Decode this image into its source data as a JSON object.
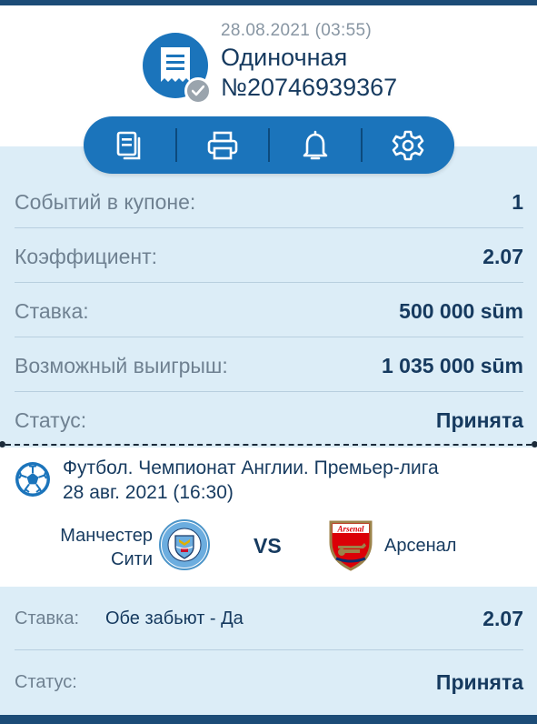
{
  "coupon": {
    "date": "28.08.2021 (03:55)",
    "type": "Одиночная",
    "number": "№20746939367"
  },
  "toolbar": {
    "icons": [
      "copy-icon",
      "print-icon",
      "bell-icon",
      "settings-icon"
    ]
  },
  "summary": [
    {
      "label": "Событий в купоне:",
      "value": "1"
    },
    {
      "label": "Коэффициент:",
      "value": "2.07"
    },
    {
      "label": "Ставка:",
      "value": "500 000 sūm"
    },
    {
      "label": "Возможный выигрыш:",
      "value": "1 035 000 sūm"
    },
    {
      "label": "Статус:",
      "value": "Принята"
    }
  ],
  "event": {
    "league": "Футбол. Чемпионат Англии. Премьер-лига",
    "date": "28 авг. 2021 (16:30)",
    "home_team_line1": "Манчестер",
    "home_team_line2": "Сити",
    "vs": "VS",
    "away_team": "Арсенал",
    "away_crest_text": "Arsenal",
    "home_crest_text": "MANCHESTER CITY"
  },
  "bet": {
    "stake_label": "Ставка:",
    "market": "Обе забьют - Да",
    "odds": "2.07",
    "status_label": "Статус:",
    "status_value": "Принята"
  },
  "colors": {
    "brand_blue": "#1b74bb",
    "navy": "#1c4c77",
    "text_dark": "#163a5f",
    "text_muted": "#6f8191",
    "panel_bg": "#dcedf7"
  }
}
